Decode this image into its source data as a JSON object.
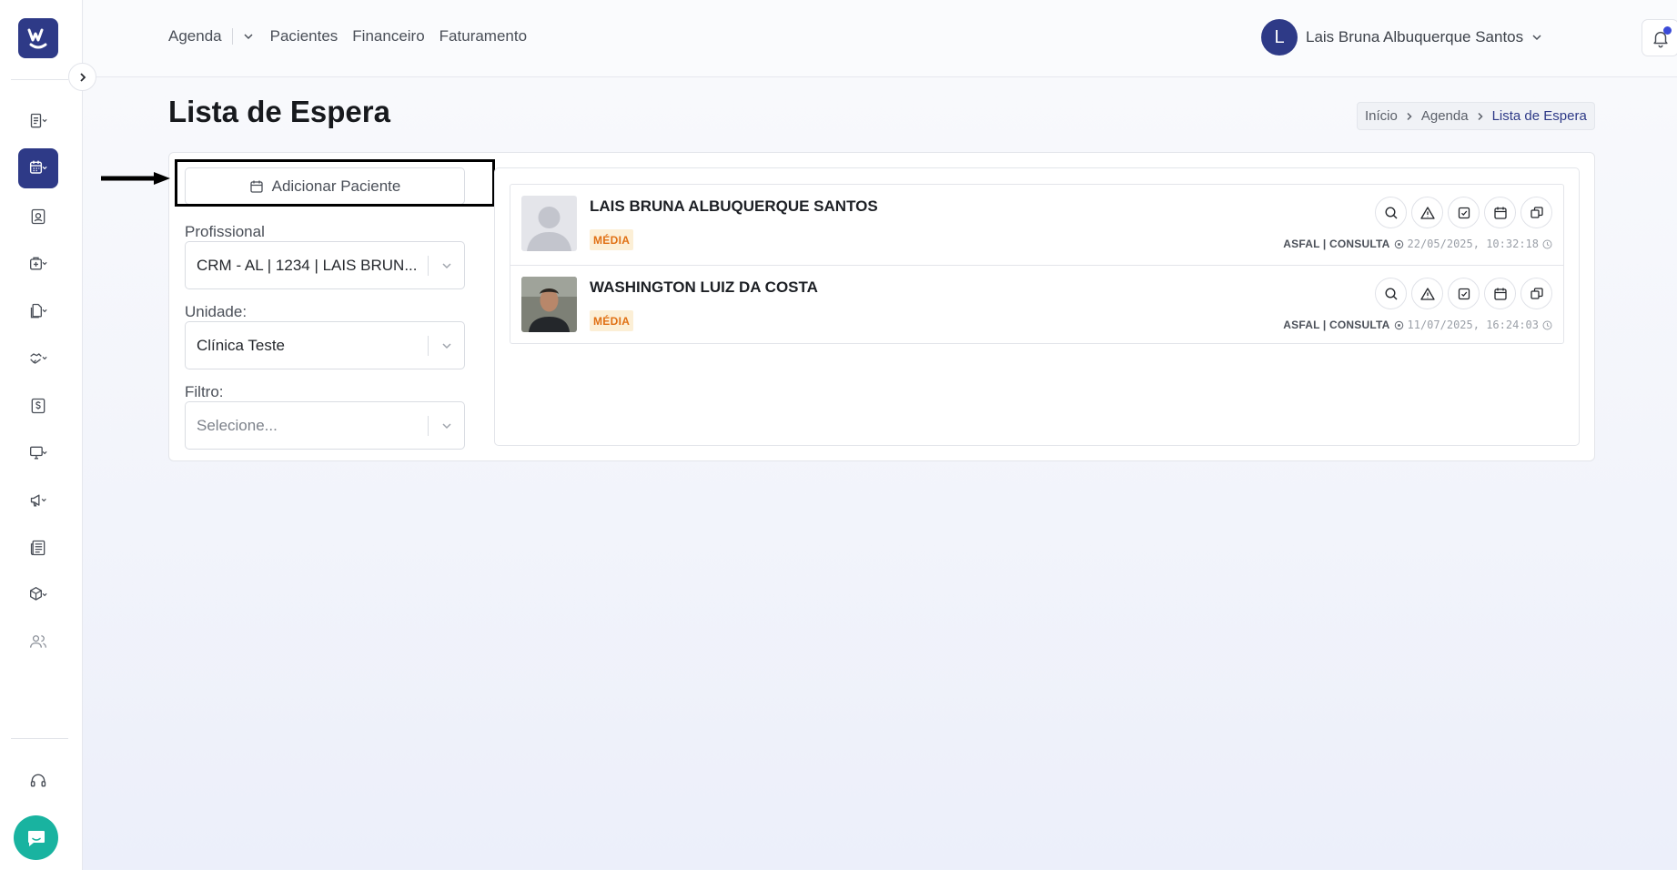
{
  "nav": {
    "agenda": "Agenda",
    "pacientes": "Pacientes",
    "financeiro": "Financeiro",
    "faturamento": "Faturamento"
  },
  "user": {
    "initial": "L",
    "name": "Lais Bruna Albuquerque Santos"
  },
  "page": {
    "title": "Lista de Espera"
  },
  "breadcrumb": {
    "items": [
      "Início",
      "Agenda",
      "Lista de Espera"
    ]
  },
  "add_button": {
    "label": "Adicionar Paciente"
  },
  "filters": {
    "profissional": {
      "label": "Profissional",
      "value": "CRM - AL | 1234 | LAIS BRUN..."
    },
    "unidade": {
      "label": "Unidade:",
      "value": "Clínica Teste"
    },
    "filtro": {
      "label": "Filtro:",
      "placeholder": "Selecione..."
    }
  },
  "waitlist": [
    {
      "name": "LAIS BRUNA ALBUQUERQUE SANTOS",
      "priority": "MÉDIA",
      "procedure": "ASFAL | CONSULTA",
      "datetime": "22/05/2025, 10:32:18",
      "photo": "default-avatar"
    },
    {
      "name": "WASHINGTON LUIZ DA COSTA",
      "priority": "MÉDIA",
      "procedure": "ASFAL | CONSULTA",
      "datetime": "11/07/2025, 16:24:03",
      "photo": "patient-photo"
    }
  ],
  "colors": {
    "primary": "#2e3a87",
    "badge_bg": "#fcefd6",
    "badge_text": "#e07014",
    "chat": "#19b3a0"
  }
}
